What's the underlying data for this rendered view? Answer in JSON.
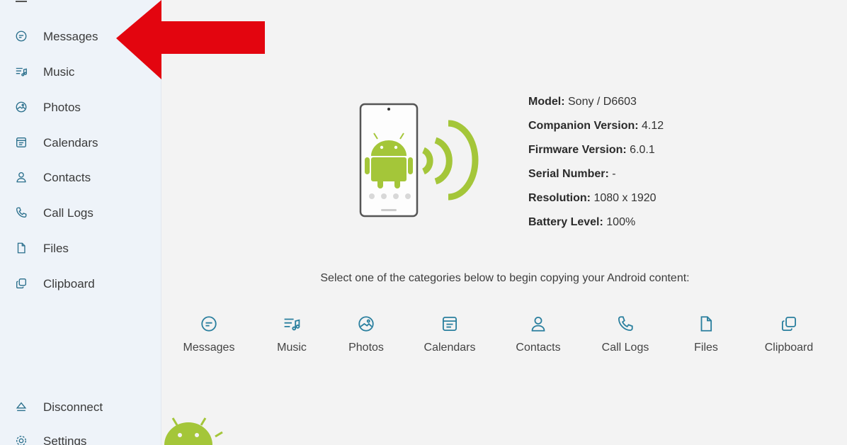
{
  "sidebar": {
    "items": [
      {
        "label": "Messages",
        "icon": "message-icon"
      },
      {
        "label": "Music",
        "icon": "music-icon"
      },
      {
        "label": "Photos",
        "icon": "photo-icon"
      },
      {
        "label": "Calendars",
        "icon": "calendar-icon"
      },
      {
        "label": "Contacts",
        "icon": "contact-icon"
      },
      {
        "label": "Call Logs",
        "icon": "phone-icon"
      },
      {
        "label": "Files",
        "icon": "file-icon"
      },
      {
        "label": "Clipboard",
        "icon": "clipboard-icon"
      }
    ],
    "bottom": [
      {
        "label": "Disconnect",
        "icon": "eject-icon"
      },
      {
        "label": "Settings",
        "icon": "gear-icon"
      }
    ]
  },
  "device": {
    "model_label": "Model:",
    "model_value": "Sony / D6603",
    "companion_label": "Companion Version:",
    "companion_value": "4.12",
    "firmware_label": "Firmware Version:",
    "firmware_value": "6.0.1",
    "serial_label": "Serial Number:",
    "serial_value": "-",
    "resolution_label": "Resolution:",
    "resolution_value": "1080 x 1920",
    "battery_label": "Battery Level:",
    "battery_value": "100%"
  },
  "instructions": "Select one of the categories below to begin copying your Android content:",
  "categories": [
    {
      "label": "Messages",
      "icon": "message-icon"
    },
    {
      "label": "Music",
      "icon": "music-icon"
    },
    {
      "label": "Photos",
      "icon": "photo-icon"
    },
    {
      "label": "Calendars",
      "icon": "calendar-icon"
    },
    {
      "label": "Contacts",
      "icon": "contact-icon"
    },
    {
      "label": "Call Logs",
      "icon": "phone-icon"
    },
    {
      "label": "Files",
      "icon": "file-icon"
    },
    {
      "label": "Clipboard",
      "icon": "clipboard-icon"
    }
  ],
  "colors": {
    "accent": "#2a7f9e",
    "android_green": "#a4c639",
    "arrow_red": "#e3050f",
    "sidebar_bg": "#eef3f9",
    "page_bg": "#f3f3f3"
  }
}
